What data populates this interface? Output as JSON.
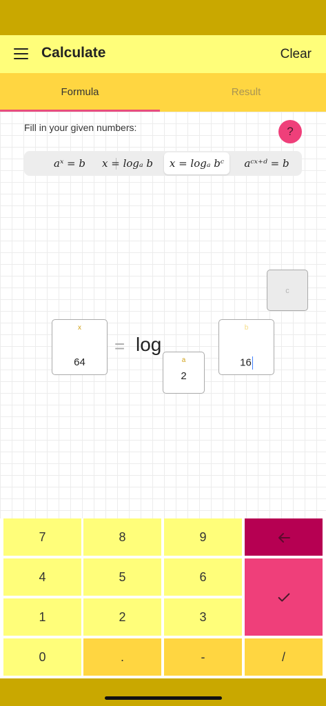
{
  "app_bar": {
    "title": "Calculate",
    "clear_label": "Clear"
  },
  "tabs": [
    {
      "label": "Formula",
      "selected": true
    },
    {
      "label": "Result",
      "selected": false
    }
  ],
  "instruction": "Fill in your given numbers:",
  "help_label": "?",
  "formula_options": [
    {
      "label": "aˣ = b",
      "selected": false
    },
    {
      "label": "x = logₐ b",
      "selected": false
    },
    {
      "label": "x = logₐ bᶜ",
      "selected": true
    },
    {
      "label": "aᶜˣ⁺ᵈ = b",
      "selected": false
    }
  ],
  "equation": {
    "x": {
      "label": "x",
      "value": "64"
    },
    "equals": "=",
    "log": "log",
    "a": {
      "label": "a",
      "value": "2"
    },
    "b": {
      "label": "b",
      "value": "16"
    },
    "c": {
      "label": "c",
      "value": ""
    }
  },
  "keypad": {
    "keys": [
      "7",
      "8",
      "9",
      "4",
      "5",
      "6",
      "1",
      "2",
      "3",
      "0",
      ".",
      "-",
      "/"
    ],
    "backspace_icon": "arrow-left-icon",
    "enter_icon": "checkmark-icon"
  },
  "colors": {
    "status_bar": "#c9a800",
    "app_bar": "#fffe7a",
    "tab_bar": "#ffd641",
    "accent_pink": "#ef3f7a",
    "backspace": "#b60052"
  }
}
